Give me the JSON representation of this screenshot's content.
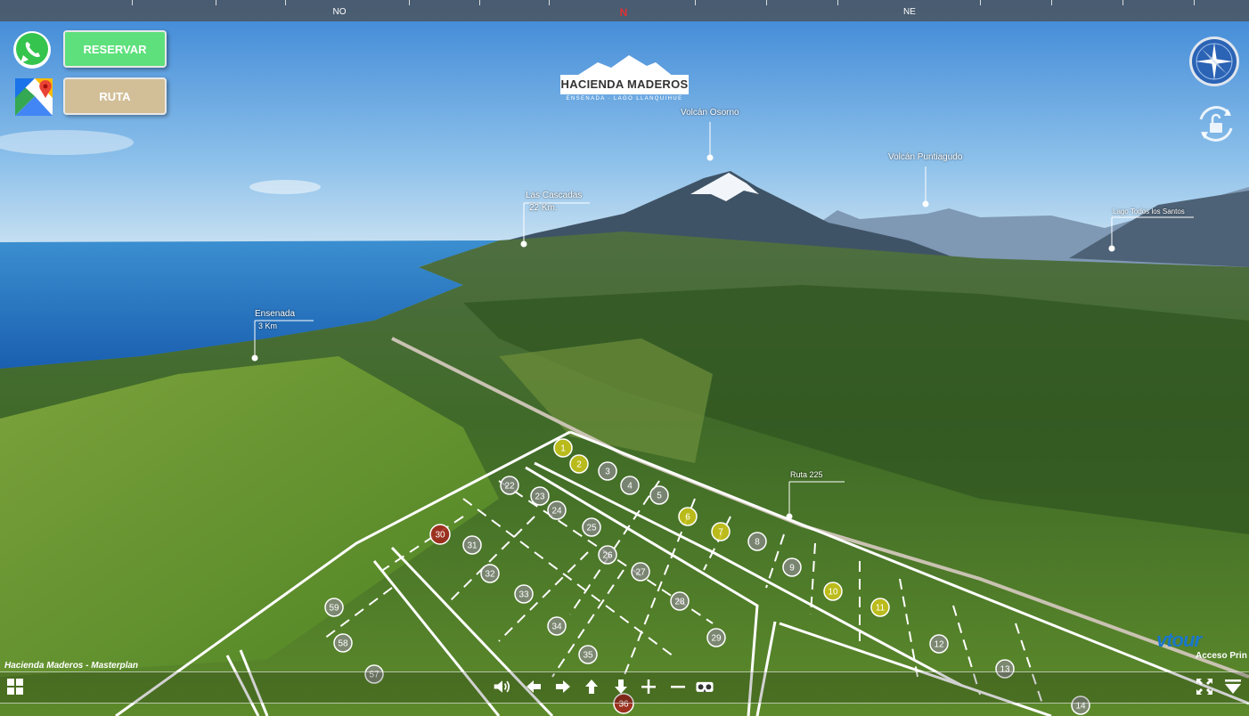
{
  "compass": {
    "labels": [
      {
        "text": "NO",
        "kind": "normal"
      },
      {
        "text": "N",
        "kind": "north"
      },
      {
        "text": "NE",
        "kind": "normal"
      }
    ]
  },
  "buttons": {
    "reserve_label": "RESERVAR",
    "route_label": "RUTA"
  },
  "logo": {
    "title": "HACIENDA MADEROS",
    "subtitle": "ENSENADA · LAGO LLANQUIHUE"
  },
  "pois": {
    "osorno": {
      "title": "Volcán Osorno"
    },
    "puntiagudo": {
      "title": "Volcán Puntiagudo"
    },
    "cascadas": {
      "title": "Las Cascadas",
      "distance": "22 Km."
    },
    "todos_santos": {
      "title": "Lago Todos los Santos"
    },
    "ensenada": {
      "title": "Ensenada",
      "distance": "3 Km"
    },
    "ruta": {
      "title": "Ruta 225"
    }
  },
  "lots": [
    {
      "n": "1",
      "status": "reserved"
    },
    {
      "n": "2",
      "status": "reserved"
    },
    {
      "n": "3",
      "status": "available"
    },
    {
      "n": "4",
      "status": "available"
    },
    {
      "n": "5",
      "status": "available"
    },
    {
      "n": "6",
      "status": "reserved"
    },
    {
      "n": "7",
      "status": "reserved"
    },
    {
      "n": "8",
      "status": "available"
    },
    {
      "n": "9",
      "status": "available"
    },
    {
      "n": "10",
      "status": "reserved"
    },
    {
      "n": "11",
      "status": "reserved"
    },
    {
      "n": "12",
      "status": "available"
    },
    {
      "n": "13",
      "status": "available"
    },
    {
      "n": "14",
      "status": "available"
    },
    {
      "n": "22",
      "status": "available"
    },
    {
      "n": "23",
      "status": "available"
    },
    {
      "n": "24",
      "status": "available"
    },
    {
      "n": "25",
      "status": "available"
    },
    {
      "n": "26",
      "status": "available"
    },
    {
      "n": "27",
      "status": "available"
    },
    {
      "n": "28",
      "status": "available"
    },
    {
      "n": "29",
      "status": "available"
    },
    {
      "n": "30",
      "status": "sold"
    },
    {
      "n": "31",
      "status": "available"
    },
    {
      "n": "32",
      "status": "available"
    },
    {
      "n": "33",
      "status": "available"
    },
    {
      "n": "34",
      "status": "available"
    },
    {
      "n": "35",
      "status": "available"
    },
    {
      "n": "36",
      "status": "sold"
    },
    {
      "n": "57",
      "status": "available"
    },
    {
      "n": "58",
      "status": "available"
    },
    {
      "n": "59",
      "status": "available"
    }
  ],
  "lot_colors": {
    "available": "#8a8a8a",
    "reserved": "#c7c31a",
    "sold": "#a2281e"
  },
  "caption": "Hacienda Maderos - Masterplan",
  "watermark": {
    "brand": "vtour",
    "link": "Acceso Prin"
  },
  "controls": [
    {
      "name": "sound-icon"
    },
    {
      "name": "arrow-left-icon"
    },
    {
      "name": "arrow-right-icon"
    },
    {
      "name": "arrow-up-icon"
    },
    {
      "name": "arrow-down-icon"
    },
    {
      "name": "zoom-in-icon"
    },
    {
      "name": "zoom-out-icon"
    },
    {
      "name": "vr-headset-icon"
    }
  ]
}
